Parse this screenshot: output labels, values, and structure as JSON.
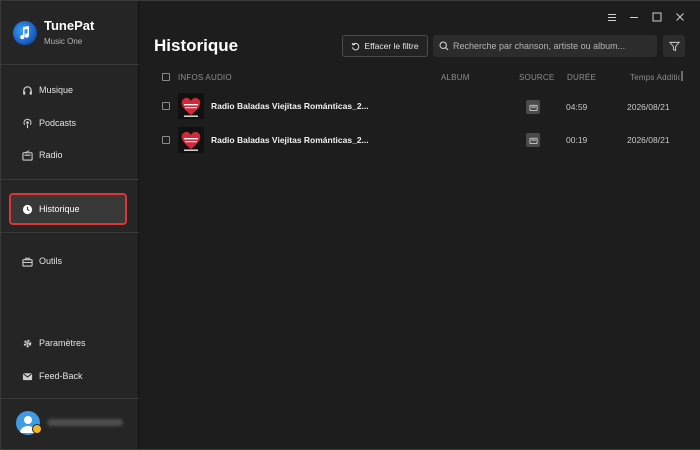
{
  "app": {
    "name": "TunePat",
    "subtitle": "Music One"
  },
  "sidebar": {
    "items": [
      {
        "label": "Musique",
        "icon": "headphones-icon"
      },
      {
        "label": "Podcasts",
        "icon": "podcast-icon"
      },
      {
        "label": "Radio",
        "icon": "radio-icon"
      },
      {
        "label": "Historique",
        "icon": "clock-icon",
        "active": true
      },
      {
        "label": "Outils",
        "icon": "toolbox-icon"
      },
      {
        "label": "Paramètres",
        "icon": "gear-icon"
      },
      {
        "label": "Feed-Back",
        "icon": "mail-icon"
      }
    ]
  },
  "header": {
    "title": "Historique",
    "clear_filter_label": "Effacer le filtre",
    "search_placeholder": "Recherche par chanson, artiste ou album..."
  },
  "table": {
    "columns": {
      "info": "INFOS AUDIO",
      "album": "ALBUM",
      "source": "SOURCE",
      "duration": "DURÉE",
      "added": "Temps Addition"
    },
    "rows": [
      {
        "title": "Radio Baladas Viejitas Románticas_2...",
        "album": "",
        "source": "radio-source-icon",
        "duration": "04:59",
        "added": "2026/08/21"
      },
      {
        "title": "Radio Baladas Viejitas Románticas_2...",
        "album": "",
        "source": "radio-source-icon",
        "duration": "00:19",
        "added": "2026/08/21"
      }
    ]
  },
  "colors": {
    "accent_highlight": "#e03535",
    "sidebar_bg": "#252525",
    "main_bg": "#1d1d1d"
  }
}
